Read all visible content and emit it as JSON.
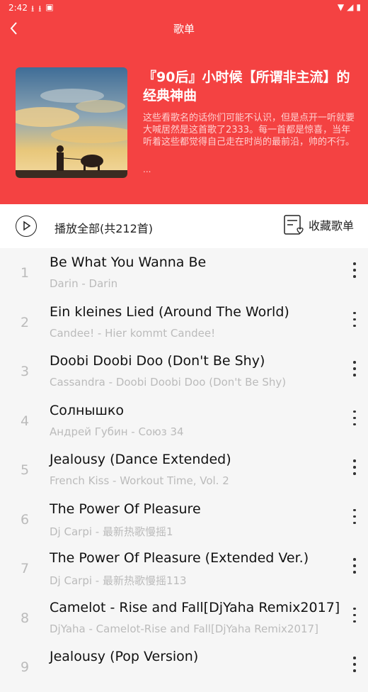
{
  "status": {
    "time": "2:42"
  },
  "header": {
    "title": "歌单",
    "playlist_title": "『90后』小时候【所谓非主流】的经典神曲",
    "description": "这些看歌名的话你们可能不认识，但是点开一听就要大喊居然是这首歌了2333。每一首都是惊喜，当年听着这些都觉得自己走在时尚的最前沿，帅的不行。",
    "description_more": "...",
    "accent": "#f44242"
  },
  "actions": {
    "play_all": "播放全部(共212首)",
    "collect": "收藏歌单"
  },
  "songs": [
    {
      "num": "1",
      "title": "Be What You Wanna Be",
      "sub": "Darin - Darin"
    },
    {
      "num": "2",
      "title": "Ein kleines Lied (Around The World)",
      "sub": "Candee! - Hier kommt Candee!"
    },
    {
      "num": "3",
      "title": "Doobi Doobi Doo (Don't Be Shy)",
      "sub": "Cassandra - Doobi Doobi Doo (Don't Be Shy)"
    },
    {
      "num": "4",
      "title": "Солнышко",
      "sub": "Андрей Губин - Союз 34"
    },
    {
      "num": "5",
      "title": "Jealousy (Dance Extended)",
      "sub": "French Kiss - Workout Time, Vol. 2"
    },
    {
      "num": "6",
      "title": "The Power Of Pleasure",
      "sub": "Dj Carpi - 最新热歌慢摇1"
    },
    {
      "num": "7",
      "title": "The Power Of Pleasure (Extended Ver.)",
      "sub": "Dj Carpi - 最新热歌慢摇113"
    },
    {
      "num": "8",
      "title": "Camelot - Rise and Fall[DjYaha Remix2017]",
      "sub": "DjYaha - Camelot-Rise and Fall[DjYaha Remix2017]"
    },
    {
      "num": "9",
      "title": "Jealousy (Pop Version)",
      "sub": ""
    }
  ]
}
